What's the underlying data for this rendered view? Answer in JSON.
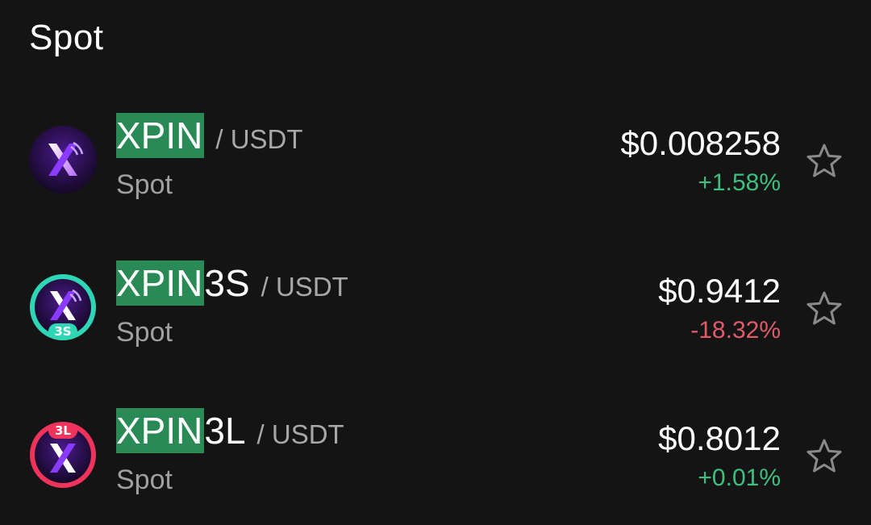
{
  "section": {
    "title": "Spot"
  },
  "rows": [
    {
      "highlight": "XPIN",
      "suffix": "",
      "quote": "/ USDT",
      "market": "Spot",
      "price": "$0.008258",
      "change": "+1.58%",
      "change_color": "#3fbf7f",
      "logo_badge": "",
      "logo_ring": "#1a1030",
      "star_icon": "star-outline-icon"
    },
    {
      "highlight": "XPIN",
      "suffix": "3S",
      "quote": "/ USDT",
      "market": "Spot",
      "price": "$0.9412",
      "change": "-18.32%",
      "change_color": "#e05a6a",
      "logo_badge": "3S",
      "logo_ring": "#2fd6b5",
      "star_icon": "star-outline-icon"
    },
    {
      "highlight": "XPIN",
      "suffix": "3L",
      "quote": "/ USDT",
      "market": "Spot",
      "price": "$0.8012",
      "change": "+0.01%",
      "change_color": "#3fbf7f",
      "logo_badge": "3L",
      "logo_ring": "#f0335a",
      "star_icon": "star-outline-icon"
    }
  ]
}
